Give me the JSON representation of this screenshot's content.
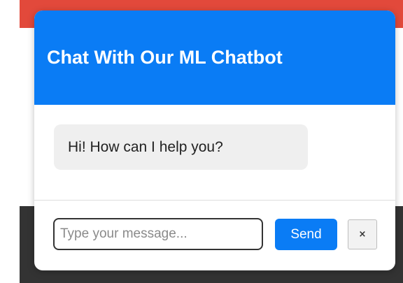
{
  "colors": {
    "header_bg": "#0a7cf5",
    "send_bg": "#0a7cf5",
    "top_strip": "#e2493b",
    "bottom_band": "#333333",
    "bot_bubble": "#efefef"
  },
  "chat": {
    "title": "Chat With Our ML Chatbot",
    "messages": [
      {
        "sender": "bot",
        "text": "Hi! How can I help you?"
      }
    ],
    "input": {
      "placeholder": "Type your message...",
      "value": ""
    },
    "send_label": "Send",
    "close_label": "×",
    "close_icon": "close-icon"
  }
}
